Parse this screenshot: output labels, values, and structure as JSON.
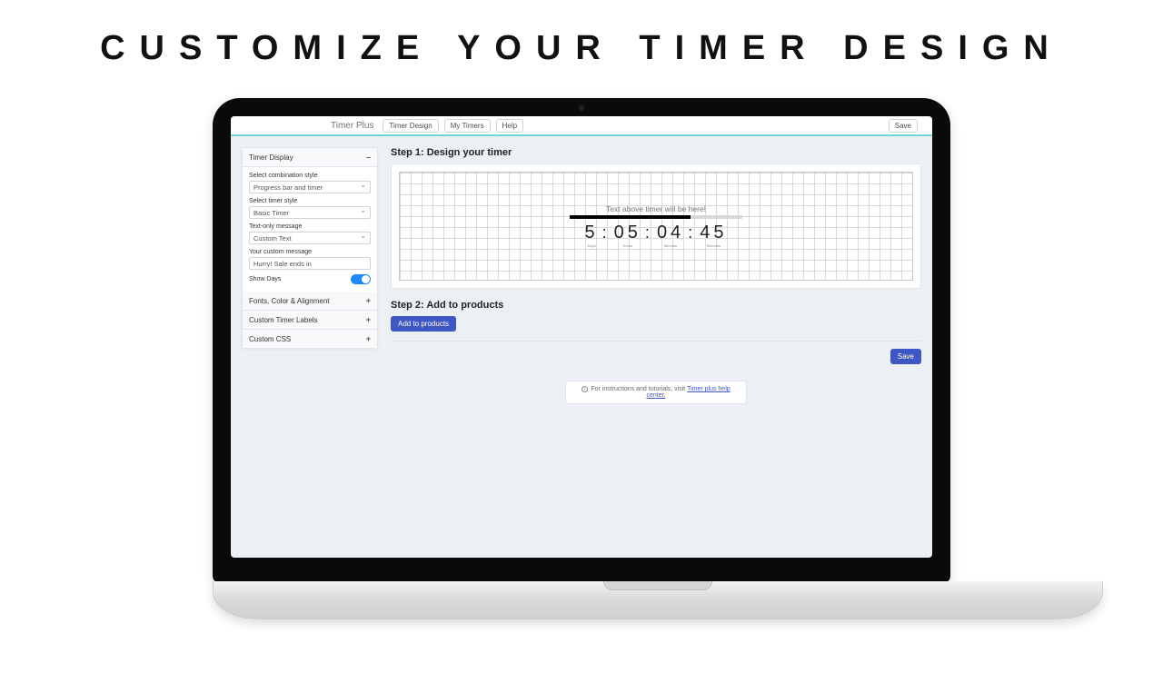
{
  "hero": {
    "title": "CUSTOMIZE YOUR TIMER DESIGN"
  },
  "topbar": {
    "brand": "Timer Plus",
    "nav": [
      "Timer Design",
      "My Timers",
      "Help"
    ],
    "save": "Save"
  },
  "sidebar": {
    "section_display": {
      "title": "Timer Display",
      "combo_label": "Select combination style",
      "combo_value": "Progress bar and timer",
      "style_label": "Select timer style",
      "style_value": "Basic Timer",
      "text_only_label": "Text-only message",
      "text_only_value": "Custom Text",
      "custom_msg_label": "Your custom message",
      "custom_msg_value": "Hurry! Sale ends in",
      "show_days_label": "Show Days"
    },
    "section_fonts": "Fonts, Color & Alignment",
    "section_labels": "Custom Timer Labels",
    "section_css": "Custom CSS"
  },
  "main": {
    "step1": "Step 1: Design your timer",
    "preview": {
      "text_above": "Text above timer will be here!",
      "segments": [
        {
          "num": "5",
          "lbl": "Days"
        },
        {
          "num": "05",
          "lbl": "Hours"
        },
        {
          "num": "04",
          "lbl": "Minutes"
        },
        {
          "num": "45",
          "lbl": "Seconds"
        }
      ]
    },
    "step2": "Step 2: Add to products",
    "add_btn": "Add to products",
    "save_btn": "Save"
  },
  "footer": {
    "text": "For instructions and tutorials, visit ",
    "link": "Timer plus help center."
  }
}
